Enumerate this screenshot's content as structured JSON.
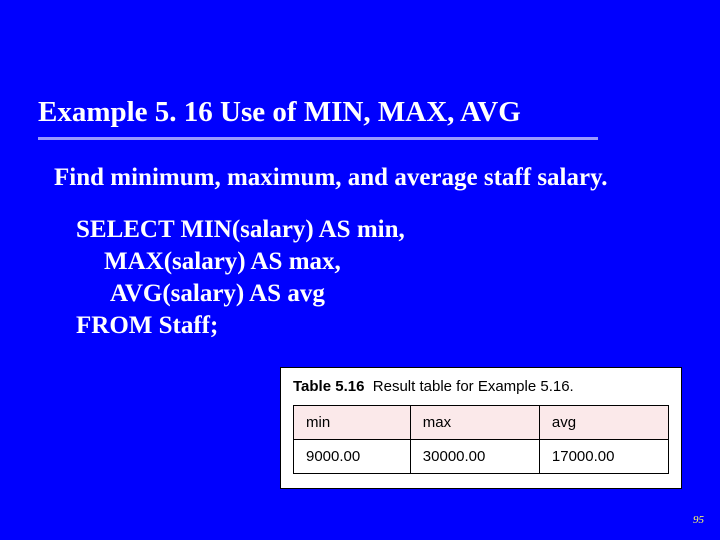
{
  "title": "Example 5. 16  Use of MIN, MAX, AVG",
  "lead": "Find minimum, maximum, and average staff salary.",
  "code": {
    "l1": "SELECT MIN(salary) AS min,",
    "l2": "MAX(salary) AS max,",
    "l3": "AVG(salary) AS avg",
    "l4": "FROM Staff;"
  },
  "table": {
    "caption_strong": "Table 5.16",
    "caption_rest": "Result table for Example 5.16.",
    "headers": {
      "c1": "min",
      "c2": "max",
      "c3": "avg"
    },
    "row": {
      "c1": "9000.00",
      "c2": "30000.00",
      "c3": "17000.00"
    }
  },
  "page_number": "95",
  "chart_data": {
    "type": "table",
    "title": "Table 5.16 Result table for Example 5.16.",
    "columns": [
      "min",
      "max",
      "avg"
    ],
    "rows": [
      {
        "min": 9000.0,
        "max": 30000.0,
        "avg": 17000.0
      }
    ]
  }
}
